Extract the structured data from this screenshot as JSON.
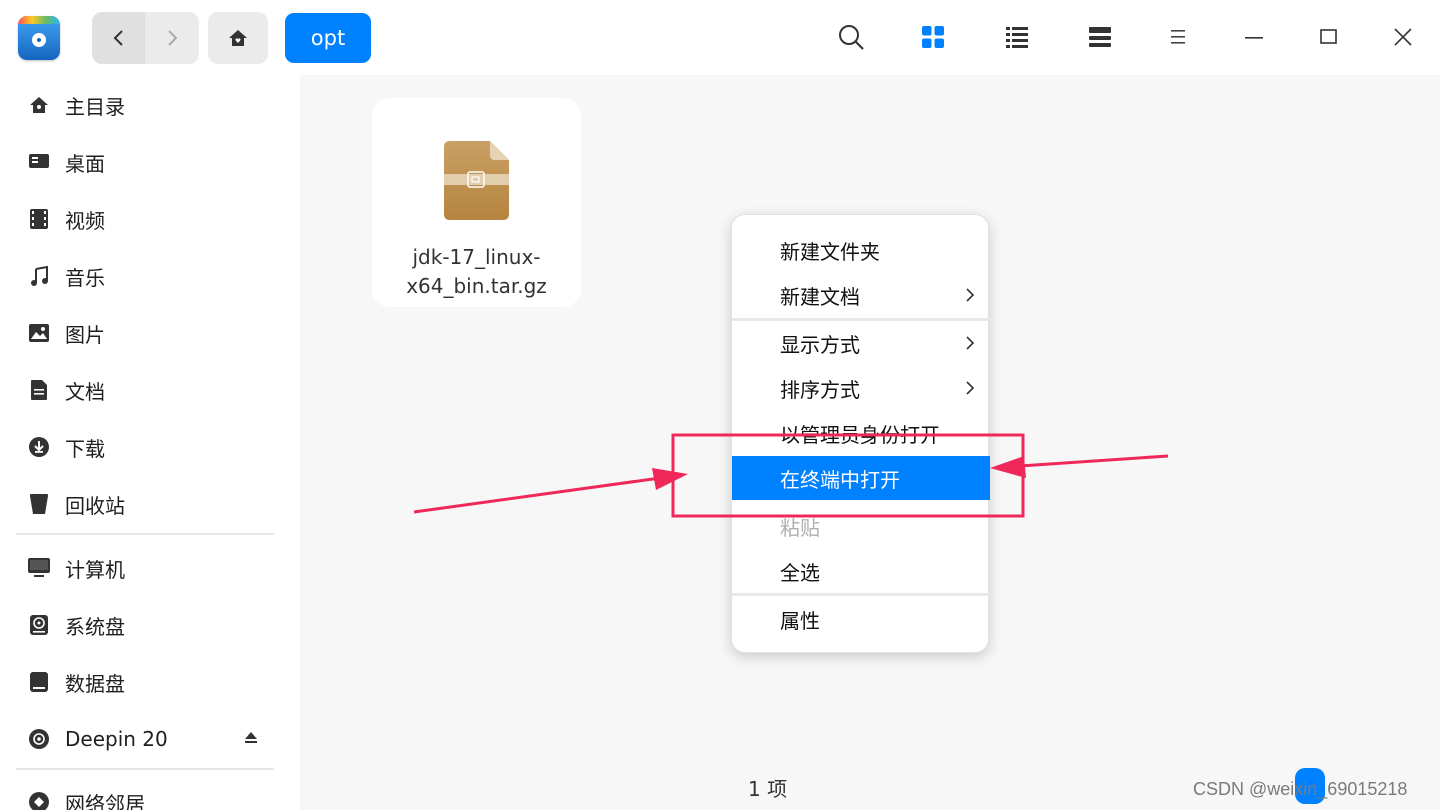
{
  "toolbar": {
    "breadcrumb": "opt"
  },
  "sidebar": {
    "items": [
      {
        "label": "主目录",
        "icon": "home-icon"
      },
      {
        "label": "桌面",
        "icon": "desktop-icon"
      },
      {
        "label": "视频",
        "icon": "video-icon"
      },
      {
        "label": "音乐",
        "icon": "music-icon"
      },
      {
        "label": "图片",
        "icon": "picture-icon"
      },
      {
        "label": "文档",
        "icon": "document-icon"
      },
      {
        "label": "下载",
        "icon": "download-icon"
      },
      {
        "label": "回收站",
        "icon": "trash-icon"
      },
      {
        "label": "计算机",
        "icon": "computer-icon"
      },
      {
        "label": "系统盘",
        "icon": "system-disk-icon"
      },
      {
        "label": "数据盘",
        "icon": "data-disk-icon"
      },
      {
        "label": "Deepin 20",
        "icon": "disc-icon"
      },
      {
        "label": "网络邻居",
        "icon": "network-icon"
      }
    ]
  },
  "main": {
    "file": {
      "name_line1": "jdk-17_linux-",
      "name_line2": "x64_bin.tar.gz",
      "icon": "archive-icon"
    },
    "status": "1 项"
  },
  "context_menu": {
    "items": [
      {
        "label": "新建文件夹"
      },
      {
        "label": "新建文档"
      },
      {
        "label": "显示方式"
      },
      {
        "label": "排序方式"
      },
      {
        "label": "以管理员身份打开"
      },
      {
        "label": "在终端中打开"
      },
      {
        "label": "粘贴"
      },
      {
        "label": "全选"
      },
      {
        "label": "属性"
      }
    ]
  },
  "watermark": "CSDN @weixin_69015218",
  "colors": {
    "accent": "#0081ff",
    "annotation": "#f0285a"
  }
}
